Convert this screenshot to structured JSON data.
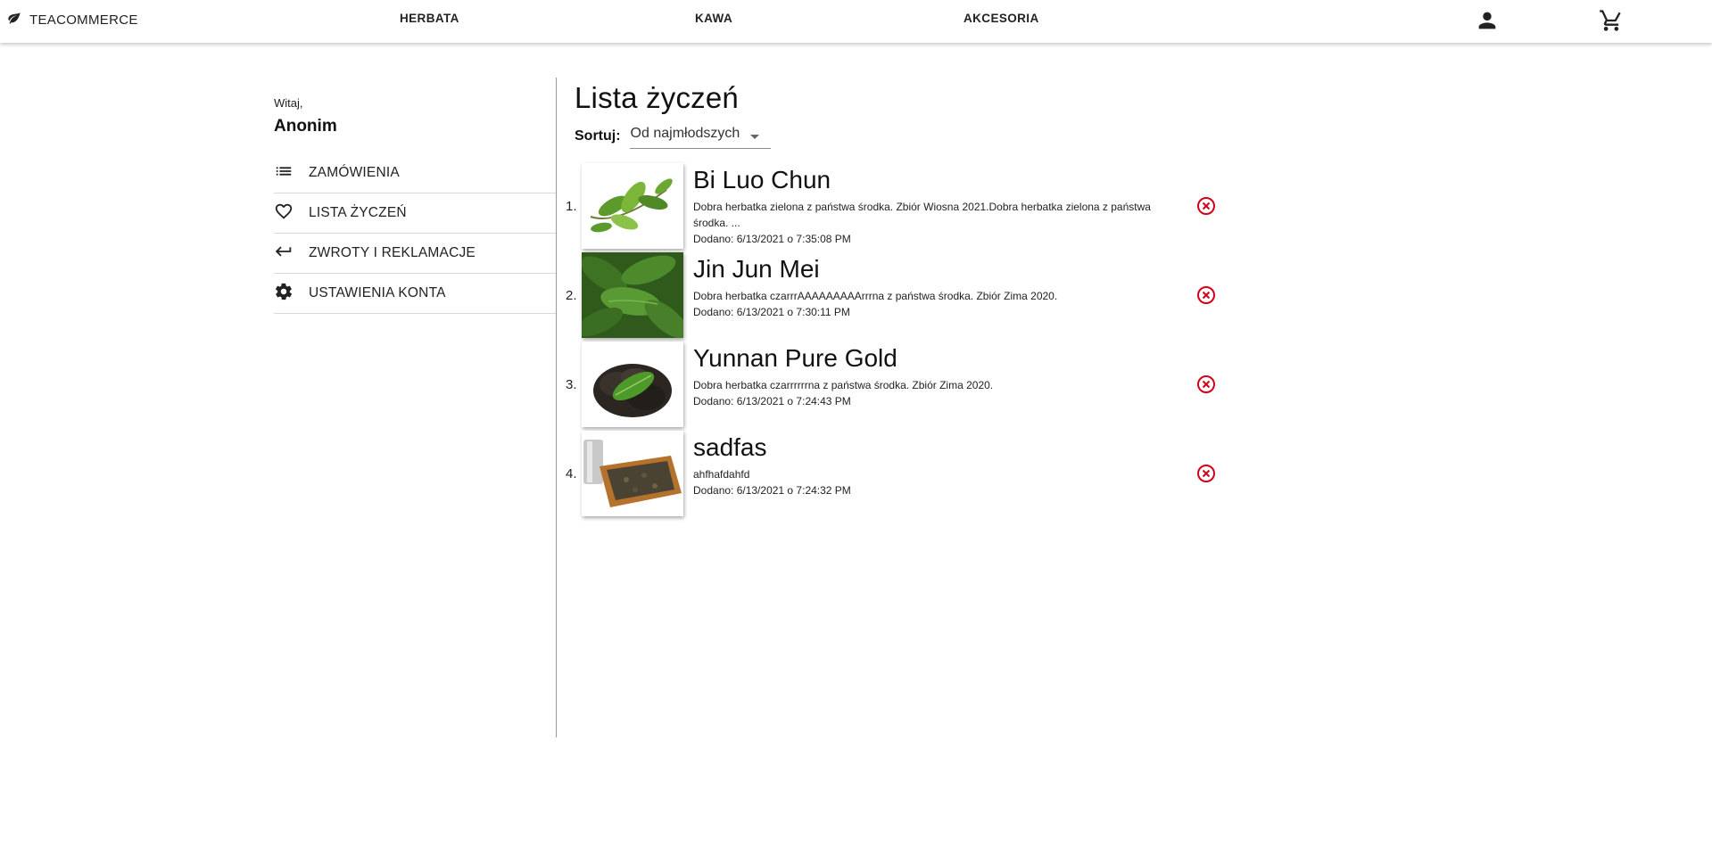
{
  "header": {
    "brand": "TEACOMMERCE",
    "brand_icon": "leaf-icon",
    "nav": [
      {
        "label": "HERBATA"
      },
      {
        "label": "KAWA"
      },
      {
        "label": "AKCESORIA"
      }
    ],
    "account_icon": "person-icon",
    "cart_icon": "cart-icon"
  },
  "sidebar": {
    "greeting": "Witaj,",
    "user_name": "Anonim",
    "menu": [
      {
        "label": "ZAMÓWIENIA",
        "icon": "list-icon"
      },
      {
        "label": "LISTA ŻYCZEŃ",
        "icon": "heart-icon"
      },
      {
        "label": "ZWROTY I REKLAMACJE",
        "icon": "return-icon"
      },
      {
        "label": "USTAWIENIA KONTA",
        "icon": "gear-icon"
      }
    ]
  },
  "main": {
    "title": "Lista życzeń",
    "sort_label": "Sortuj:",
    "sort_value": "Od najmłodszych",
    "items": [
      {
        "num": "1.",
        "name": "Bi Luo Chun",
        "description": "Dobra herbatka zielona z państwa środka. Zbiór Wiosna 2021.Dobra herbatka zielona z państwa środka. ...",
        "added": "Dodano: 6/13/2021 o 7:35:08 PM",
        "image_icon": "tea-leaves-image"
      },
      {
        "num": "2.",
        "name": "Jin Jun Mei",
        "description": "Dobra herbatka czarrrAAAAAAAAArrrna z państwa środka. Zbiór Zima 2020.",
        "added": "Dodano: 6/13/2021 o 7:30:11 PM",
        "image_icon": "tea-leaves-image"
      },
      {
        "num": "3.",
        "name": "Yunnan Pure Gold",
        "description": "Dobra herbatka czarrrrrrna z państwa środka. Zbiór Zima 2020.",
        "added": "Dodano: 6/13/2021 o 7:24:43 PM",
        "image_icon": "tea-leaves-image"
      },
      {
        "num": "4.",
        "name": "sadfas",
        "description": "ahfhafdahfd",
        "added": "Dodano: 6/13/2021 o 7:24:32 PM",
        "image_icon": "tea-box-image"
      }
    ],
    "remove_icon": "remove-circle-icon"
  },
  "colors": {
    "remove": "#d0021b",
    "text": "#111111",
    "divider": "#d8d8d8"
  }
}
